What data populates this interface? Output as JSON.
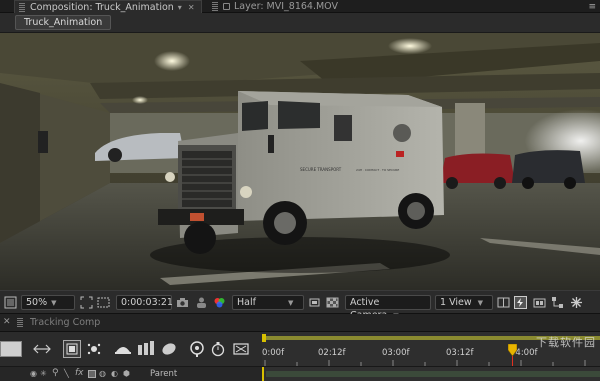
{
  "tabs": [
    {
      "label": "Composition: Truck_Animation",
      "active": true
    },
    {
      "label": "Layer: MVI_8164.MOV",
      "active": false
    }
  ],
  "breadcrumb": {
    "label": "Truck_Animation"
  },
  "viewer": {
    "zoom": "50%",
    "timecode": "0:00:03:21",
    "resolution": "Half",
    "camera": "Active Camera",
    "views": "1 View"
  },
  "timeline": {
    "comp_tab": "Tracking Comp",
    "ticks": [
      "0:00f",
      "02:12f",
      "03:00f",
      "03:12f",
      "04:00f"
    ],
    "parent_label": "Parent",
    "current_time_fraction": 0.74
  },
  "truck_text": {
    "panel": "SECURE TRANSPORT",
    "panel2": "24H · CONTACT · TO SECURE"
  },
  "watermark": "下载软件园",
  "colors": {
    "background": "#232323",
    "panel": "#2b2b2b",
    "playhead": "#e8b400",
    "work_area": "#d8c000"
  }
}
